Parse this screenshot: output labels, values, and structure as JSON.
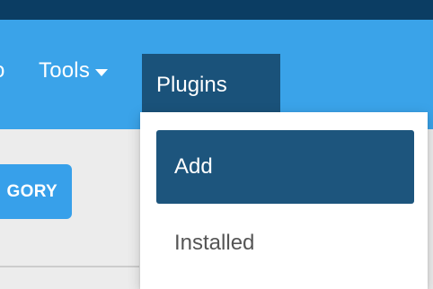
{
  "navbar": {
    "partial_item_label": "o",
    "items": [
      {
        "label": "Tools",
        "icon": "caret-down-icon"
      },
      {
        "label": "Plugins",
        "icon": "caret-down-icon",
        "active": true
      }
    ]
  },
  "dropdown": {
    "items": [
      {
        "label": "Add",
        "state": "highlighted"
      },
      {
        "label": "Installed"
      }
    ]
  },
  "toolbar": {
    "category_button_label": "GORY"
  },
  "colors": {
    "topbar": "#0b3d63",
    "navbar": "#3aa3e9",
    "active_nav": "#1a527a",
    "highlight": "#1d557d",
    "button": "#37a0ea",
    "content_bg": "#ececec"
  }
}
